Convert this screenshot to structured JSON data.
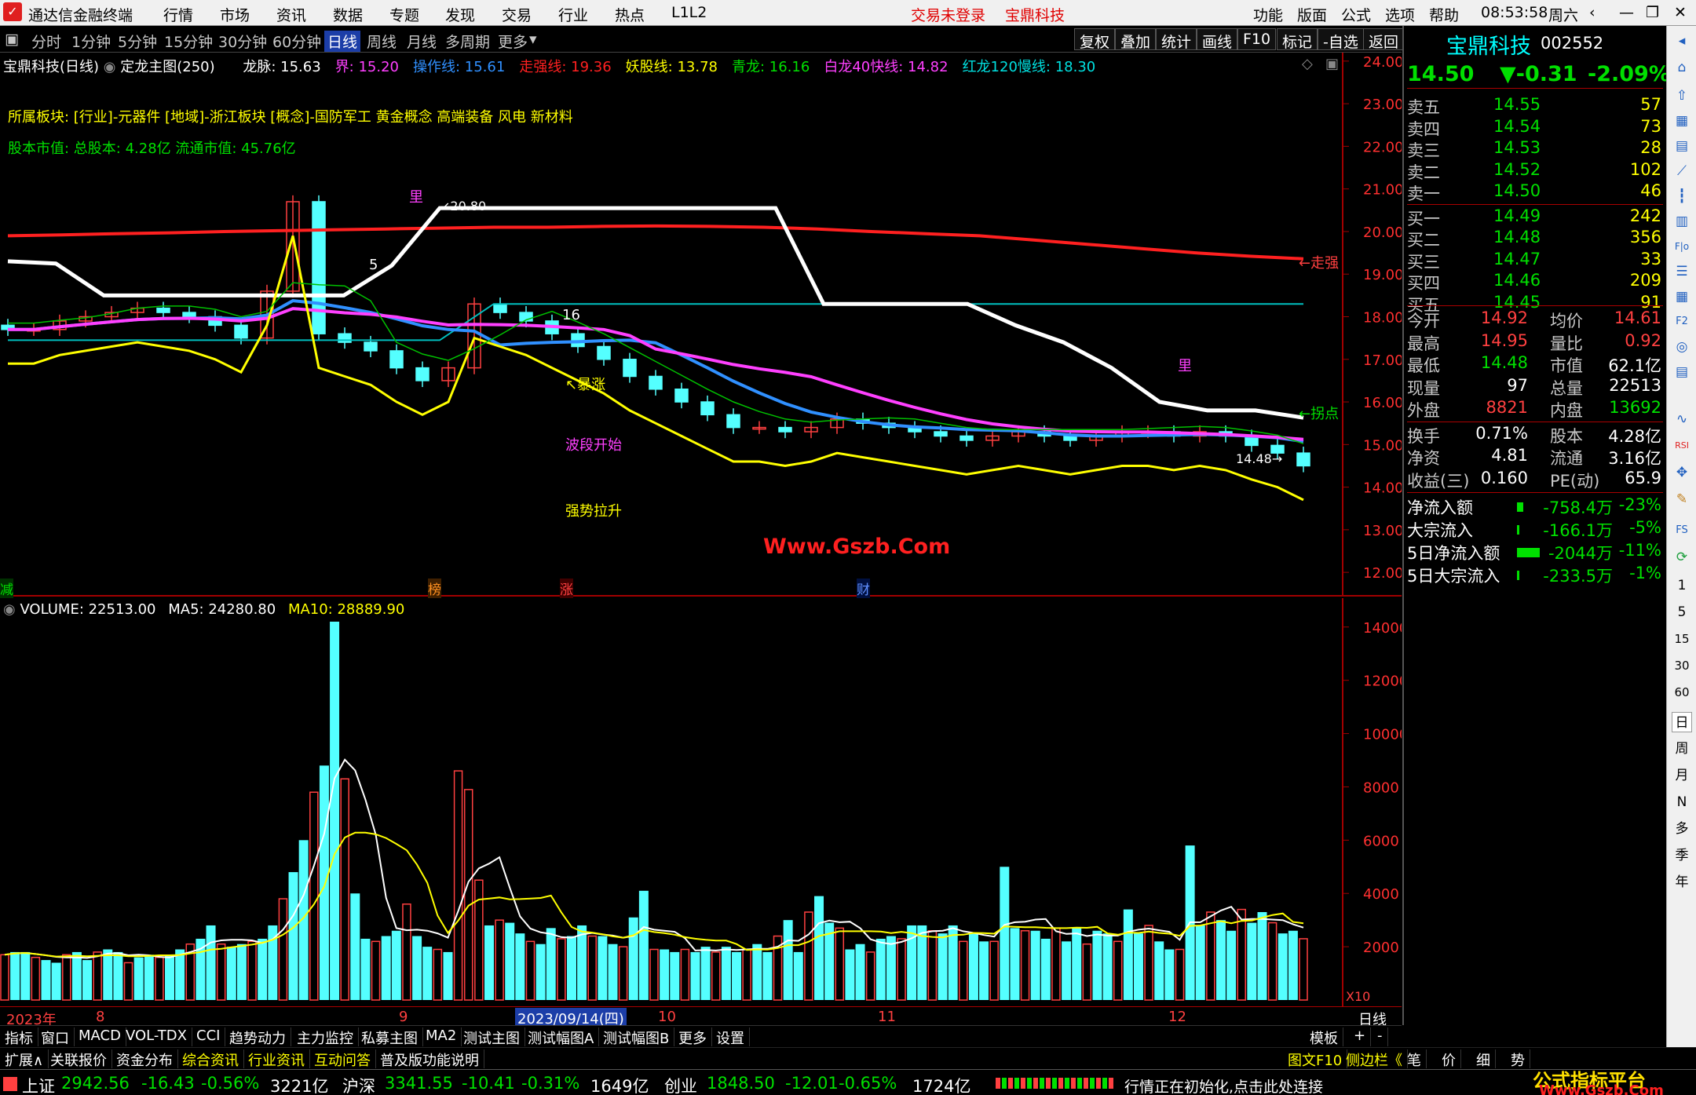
{
  "titlebar": {
    "app_name": "通达信金融终端",
    "menu_left": [
      "行情",
      "市场",
      "资讯",
      "数据",
      "专题",
      "发现",
      "交易",
      "行业",
      "热点",
      "L1L2"
    ],
    "trade_status": "交易未登录",
    "stock_name": "宝鼎科技",
    "menu_right": [
      "功能",
      "版面",
      "公式",
      "选项",
      "帮助"
    ],
    "time": "08:53:58",
    "weekday": "周六"
  },
  "periodbar": {
    "periods": [
      "分时",
      "1分钟",
      "5分钟",
      "15分钟",
      "30分钟",
      "60分钟",
      "日线",
      "周线",
      "月线",
      "多周期",
      "更多"
    ],
    "active": "日线",
    "right_buttons": [
      "复权",
      "叠加",
      "统计",
      "画线",
      "F10",
      "标记",
      "-自选",
      "返回"
    ]
  },
  "main_legend": {
    "title": "宝鼎科技(日线)",
    "formula": "定龙主图(250)",
    "items": [
      {
        "label": "龙脉: 15.63",
        "color": "#ffffff"
      },
      {
        "label": "界: 15.20",
        "color": "#ff40ff"
      },
      {
        "label": "操作线: 15.61",
        "color": "#3090ff"
      },
      {
        "label": "走强线: 19.36",
        "color": "#ff2020"
      },
      {
        "label": "妖股线: 13.78",
        "color": "#ffff00"
      },
      {
        "label": "青龙: 16.16",
        "color": "#00e000"
      },
      {
        "label": "白龙40快线: 14.82",
        "color": "#ff40ff"
      },
      {
        "label": "红龙120慢线: 18.30",
        "color": "#00e0e0"
      }
    ],
    "sector": "所属板块: [行业]-元器件 [地域]-浙江板块 [概念]-国防军工 黄金概念 高端装备 风电 新材料",
    "capital": "股本市值: 总股本: 4.28亿 流通市值: 45.76亿"
  },
  "main_annotations": {
    "high_label": "20.80",
    "low_label": "14.48",
    "baozhang": "暴涨",
    "boduan": "波段开始",
    "qiangshi": "强势拉升",
    "zouqiang": "走强",
    "guaidian": "拐点",
    "li1": "里",
    "li2": "里",
    "five": "5",
    "sixteen": "16",
    "watermark": "Www.Gszb.Com",
    "marker_jian": "减",
    "marker_bang": "榜",
    "marker_zhang": "涨",
    "marker_cai": "财"
  },
  "volume_legend": {
    "volume": "VOLUME: 22513.00",
    "ma5": "MA5: 24280.80",
    "ma10": "MA10: 28889.90",
    "x10": "X10"
  },
  "chart_data": [
    {
      "type": "candlestick",
      "title": "宝鼎科技(日线)",
      "ylim": [
        11.8,
        24.2
      ],
      "yticks": [
        "24.00",
        "23.00",
        "22.00",
        "21.00",
        "20.00",
        "19.00",
        "18.00",
        "17.00",
        "16.00",
        "15.00",
        "14.00",
        "13.00",
        "12.00"
      ],
      "lines": {
        "zouqiang_red": [
          19.9,
          19.92,
          19.95,
          19.97,
          20.0,
          20.02,
          20.04,
          20.06,
          20.08,
          20.1,
          20.1,
          20.12,
          20.13,
          20.12,
          20.1,
          20.06,
          20.0,
          19.95,
          19.9,
          19.8,
          19.7,
          19.6,
          19.5,
          19.42,
          19.36
        ],
        "cyan_flat": [
          17.45,
          17.45,
          17.45,
          17.45,
          17.45,
          17.45,
          17.45,
          17.45,
          17.45,
          18.3,
          18.3,
          18.3,
          18.3,
          18.3,
          18.3,
          18.3,
          18.3,
          18.3,
          18.3,
          18.3,
          18.3,
          18.3,
          18.3,
          18.3,
          18.3
        ],
        "longmai_white": [
          19.3,
          19.25,
          18.5,
          18.5,
          18.5,
          18.5,
          18.5,
          18.5,
          19.2,
          20.55,
          20.55,
          20.55,
          20.55,
          20.55,
          20.55,
          20.55,
          20.55,
          18.3,
          18.3,
          18.3,
          18.3,
          17.8,
          17.4,
          16.8,
          16.0,
          15.8,
          15.8,
          15.63
        ]
      },
      "candles_close": [
        17.7,
        17.7,
        17.9,
        18.0,
        18.1,
        18.2,
        18.1,
        18.0,
        17.8,
        17.5,
        18.6,
        20.7,
        17.6,
        17.4,
        17.2,
        16.8,
        16.5,
        16.8,
        18.3,
        18.1,
        17.9,
        17.6,
        17.3,
        17.0,
        16.6,
        16.3,
        16.0,
        15.7,
        15.4,
        15.4,
        15.3,
        15.4,
        15.6,
        15.5,
        15.4,
        15.3,
        15.2,
        15.1,
        15.2,
        15.3,
        15.2,
        15.1,
        15.2,
        15.3,
        15.3,
        15.2,
        15.3,
        15.2,
        14.98,
        14.8,
        14.5
      ]
    },
    {
      "type": "bar",
      "title": "VOLUME",
      "ylim": [
        0,
        14200
      ],
      "yticks": [
        "14000",
        "12000",
        "10000",
        "8000",
        "6000",
        "4000",
        "2000"
      ],
      "values": [
        1700,
        1800,
        1800,
        1600,
        1500,
        1400,
        1700,
        1800,
        1500,
        1800,
        1900,
        1800,
        1400,
        1600,
        1700,
        1600,
        1700,
        1900,
        2100,
        2300,
        2800,
        2100,
        2000,
        2100,
        2200,
        2300,
        2800,
        3800,
        4800,
        6000,
        7800,
        8800,
        14200,
        8300,
        4000,
        2300,
        2200,
        2400,
        2600,
        3600,
        2400,
        2000,
        1900,
        1800,
        8600,
        7900,
        4500,
        2800,
        3000,
        2900,
        2500,
        2200,
        2100,
        2700,
        2300,
        2400,
        2800,
        2400,
        2400,
        2100,
        2000,
        3100,
        4100,
        1900,
        1900,
        1800,
        1900,
        1800,
        2000,
        1800,
        2000,
        1800,
        1900,
        2100,
        1800,
        2400,
        3000,
        1800,
        3300,
        3900,
        2900,
        2700,
        1900,
        2100,
        1800,
        2300,
        2400,
        2300,
        2800,
        2800,
        2600,
        2500,
        2800,
        2200,
        2500,
        2200,
        2200,
        5000,
        2700,
        2600,
        2600,
        2300,
        2700,
        2200,
        2700,
        2100,
        2600,
        2500,
        2200,
        3400,
        2500,
        2800,
        2200,
        1900,
        1900,
        5800,
        2800,
        3300,
        3000,
        2600,
        3400,
        2900,
        3300,
        2900,
        2500,
        2600,
        2300
      ]
    }
  ],
  "xaxis": {
    "labels": [
      "2023年",
      "8",
      "9",
      "2023/09/14(四)",
      "10",
      "11",
      "12"
    ],
    "period_label": "日线"
  },
  "tabs1": [
    "指标",
    "窗口",
    "MACD",
    "VOL-TDX",
    "CCI",
    "趋势动力",
    "主力监控",
    "私募主图",
    "MA2",
    "测试主图",
    "测试幅图A",
    "测试幅图B",
    "更多",
    "设置"
  ],
  "tabs1_right": [
    "模板",
    "+",
    "-"
  ],
  "tabs2": [
    "扩展∧",
    "关联报价",
    "资金分布",
    "综合资讯",
    "行业资讯",
    "互动问答",
    "普及版功能说明"
  ],
  "tabs2_right": [
    "图文F10",
    "侧边栏《",
    "笔",
    "价",
    "细",
    "势"
  ],
  "statusbar": {
    "sh_name": "上证",
    "sh_val": "2942.56",
    "sh_chg": "-16.43",
    "sh_pct": "-0.56%",
    "sh_amt": "3221亿",
    "hs_name": "沪深",
    "hs_val": "3341.55",
    "hs_chg": "-10.41",
    "hs_pct": "-0.31%",
    "hs_amt": "1649亿",
    "cy_name": "创业",
    "cy_val": "1848.50",
    "cy_chg": "-12.01",
    "cy_pct": "-0.65%",
    "cy_amt": "1724亿",
    "msg": "行情正在初始化,点击此处连接",
    "brand1": "公式指标平台",
    "brand2": "Www.Gszb.Com"
  },
  "quote": {
    "name": "宝鼎科技",
    "code": "002552",
    "price": "14.50",
    "change": "▼-0.31",
    "pct": "-2.09%",
    "asks": [
      {
        "label": "卖五",
        "price": "14.55",
        "vol": "57"
      },
      {
        "label": "卖四",
        "price": "14.54",
        "vol": "73"
      },
      {
        "label": "卖三",
        "price": "14.53",
        "vol": "28"
      },
      {
        "label": "卖二",
        "price": "14.52",
        "vol": "102"
      },
      {
        "label": "卖一",
        "price": "14.50",
        "vol": "46"
      }
    ],
    "bids": [
      {
        "label": "买一",
        "price": "14.49",
        "vol": "242"
      },
      {
        "label": "买二",
        "price": "14.48",
        "vol": "356"
      },
      {
        "label": "买三",
        "price": "14.47",
        "vol": "33"
      },
      {
        "label": "买四",
        "price": "14.46",
        "vol": "209"
      },
      {
        "label": "买五",
        "price": "14.45",
        "vol": "91"
      }
    ],
    "stats": [
      {
        "l1": "今开",
        "v1": "14.92",
        "c1": "up",
        "l2": "均价",
        "v2": "14.61",
        "c2": "up"
      },
      {
        "l1": "最高",
        "v1": "14.95",
        "c1": "up",
        "l2": "量比",
        "v2": "0.92",
        "c2": "up"
      },
      {
        "l1": "最低",
        "v1": "14.48",
        "c1": "dn",
        "l2": "市值",
        "v2": "62.1亿",
        "c2": "wh"
      },
      {
        "l1": "现量",
        "v1": "97",
        "c1": "wh",
        "l2": "总量",
        "v2": "22513",
        "c2": "wh"
      },
      {
        "l1": "外盘",
        "v1": "8821",
        "c1": "up",
        "l2": "内盘",
        "v2": "13692",
        "c2": "dn"
      }
    ],
    "stats2": [
      {
        "l1": "换手",
        "v1": "0.71%",
        "l2": "股本",
        "v2": "4.28亿"
      },
      {
        "l1": "净资",
        "v1": "4.81",
        "l2": "流通",
        "v2": "3.16亿"
      },
      {
        "l1": "收益(三)",
        "v1": "0.160",
        "l2": "PE(动)",
        "v2": "65.9"
      }
    ],
    "flows": [
      {
        "label": "净流入额",
        "val": "-758.4万",
        "pct": "-23%",
        "bar": 0.23
      },
      {
        "label": "大宗流入",
        "val": "-166.1万",
        "pct": "-5%",
        "bar": 0.05
      },
      {
        "label": "5日净流入额",
        "val": "-2044万",
        "pct": "-11%",
        "bar": 0.8
      },
      {
        "label": "5日大宗流入",
        "val": "-233.5万",
        "pct": "-1%",
        "bar": 0.03
      }
    ]
  },
  "sidebar_labels": [
    "1",
    "5",
    "15",
    "30",
    "60",
    "日",
    "周",
    "月",
    "N",
    "多",
    "季",
    "年"
  ],
  "colors": {
    "up": "#ff4040",
    "down": "#00e000",
    "candle_down": "#54ffff",
    "zouqiang": "#ff2020",
    "longmai": "#ffffff",
    "operate": "#3090ff",
    "yao": "#ffff00",
    "magenta": "#ff40ff"
  }
}
